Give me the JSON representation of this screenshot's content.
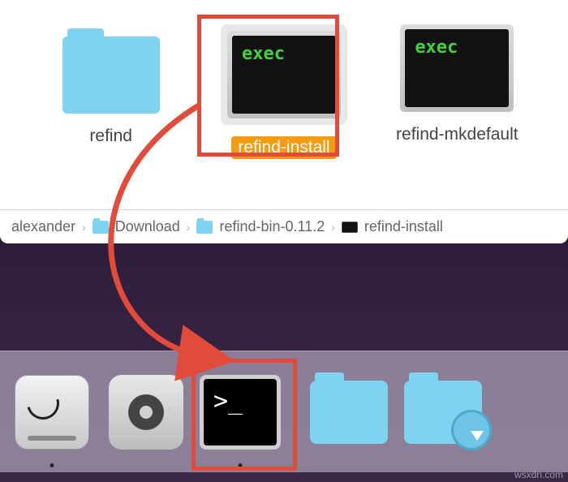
{
  "finder": {
    "items": [
      {
        "label": "refind",
        "exec_text": ""
      },
      {
        "label": "refind-install",
        "exec_text": "exec"
      },
      {
        "label": "refind-mkdefault",
        "exec_text": "exec"
      }
    ]
  },
  "breadcrumb": {
    "crumb0": "alexander",
    "crumb1": "Download",
    "crumb2": "refind-bin-0.11.2",
    "crumb3": "refind-install"
  },
  "dock": {
    "terminal_prompt": ">_"
  },
  "watermark": "wsxdn.com"
}
